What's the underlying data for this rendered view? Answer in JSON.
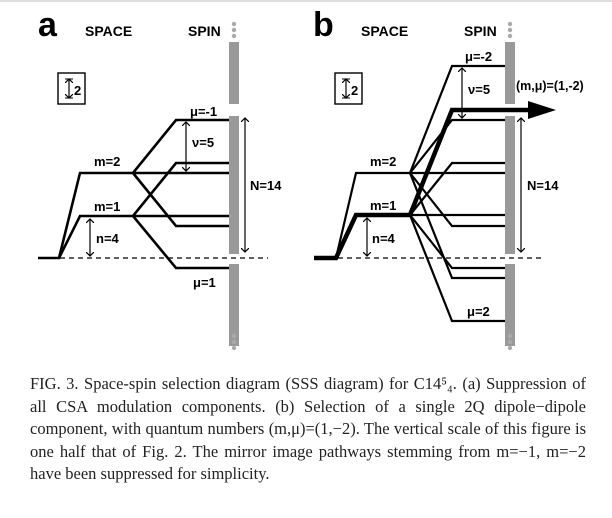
{
  "panels": [
    {
      "letter": "a",
      "space_label": "SPACE",
      "spin_label": "SPIN",
      "scale_label": "2",
      "m2_label": "m=2",
      "m1_label": "m=1",
      "n_label": "n=4",
      "nu_label": "ν=5",
      "N_label": "N=14",
      "mu_top_label": "μ=-1",
      "mu_bottom_label": "μ=1"
    },
    {
      "letter": "b",
      "space_label": "SPACE",
      "spin_label": "SPIN",
      "scale_label": "2",
      "m2_label": "m=2",
      "m1_label": "m=1",
      "n_label": "n=4",
      "nu_label": "ν=5",
      "N_label": "N=14",
      "mu_top_label": "μ=-2",
      "mu_bottom_label": "μ=2",
      "selected_label": "(m,μ)=(1,-2)"
    }
  ],
  "caption": {
    "text": "FIG. 3. Space-spin selection diagram (SSS diagram) for C14⁵₄. (a) Suppression of all CSA modulation components. (b) Selection of a single 2Q dipole−dipole component, with quantum numbers (m,μ)=(1,−2). The vertical scale of this figure is one half that of Fig. 2. The mirror image pathways stemming from m=−1, m=−2 have been suppressed for simplicity."
  }
}
